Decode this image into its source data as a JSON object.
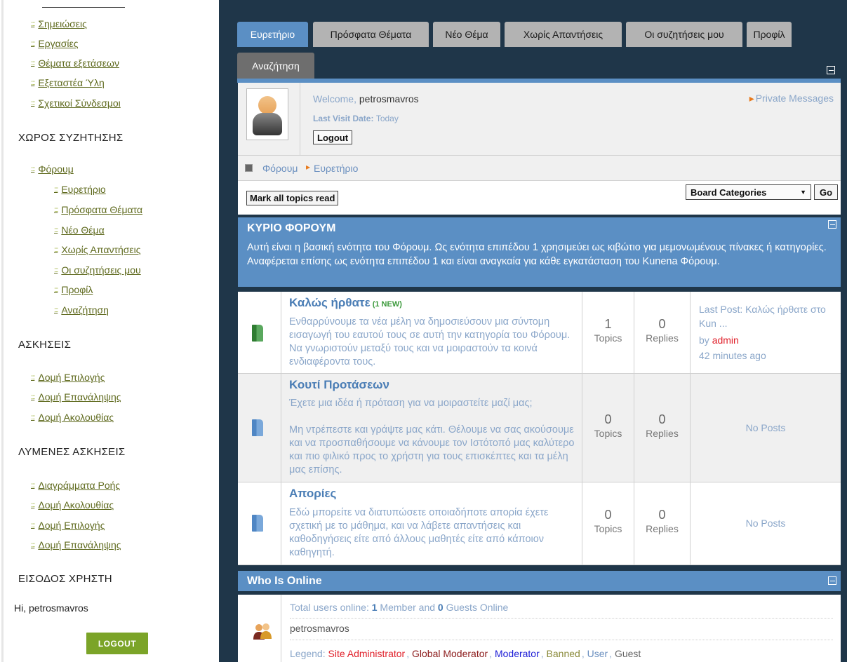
{
  "sidebar": {
    "top_links": [
      "Σημειώσεις",
      "Εργασίες",
      "Θέματα εξετάσεων",
      "Εξεταστέα Ύλη",
      "Σχετικοί Σύνδεσμοι"
    ],
    "section_forum": "ΧΩΡΟΣ ΣΥΖΗΤΗΣΗΣ",
    "forum_link": "Φόρουμ",
    "forum_sublinks": [
      "Ευρετήριο",
      "Πρόσφατα Θέματα",
      "Νέο Θέμα",
      "Χωρίς Απαντήσεις",
      "Οι συζητήσεις μου",
      "Προφίλ",
      "Αναζήτηση"
    ],
    "section_exercises": "ΑΣΚΗΣΕΙΣ",
    "exercise_links": [
      "Δομή Επιλογής",
      "Δομή Επανάληψης",
      "Δομή Ακολουθίας"
    ],
    "section_solved": "ΛΥΜΕΝΕΣ ΑΣΚΗΣΕΙΣ",
    "solved_links": [
      "Διαγράμματα Ροής",
      "Δομή Ακολουθίας",
      "Δομή Επιλογής",
      "Δομή Επανάληψης"
    ],
    "section_login": "ΕΙΣΟΔΟΣ ΧΡΗΣΤΗ",
    "greeting": "Hi, petrosmavros",
    "logout_label": "LOGOUT"
  },
  "tabs": [
    "Ευρετήριο",
    "Πρόσφατα Θέματα",
    "Νέο Θέμα",
    "Χωρίς Απαντήσεις",
    "Οι συζητήσεις μου",
    "Προφίλ",
    "Αναζήτηση"
  ],
  "userbox": {
    "welcome_prefix": "Welcome, ",
    "username": "petrosmavros",
    "last_visit_label": "Last Visit Date: ",
    "last_visit_value": "Today",
    "logout_label": "Logout",
    "private_messages": "Private Messages"
  },
  "breadcrumb": [
    "Φόρουμ",
    "Ευρετήριο"
  ],
  "toolbar": {
    "mark_read_label": "Mark all topics read",
    "board_select_value": "Board Categories",
    "go_label": "Go"
  },
  "category": {
    "title": "ΚΥΡΙΟ ΦΟΡΟΥΜ",
    "description": "Αυτή είναι η βασική ενότητα του Φόρουμ. Ως ενότητα επιπέδου 1 χρησιμεύει ως κιβώτιο για μεμονωμένους πίνακες ή κατηγορίες. Αναφέρεται επίσης ως ενότητα επιπέδου 1 και είναι αναγκαία για κάθε εγκατάσταση του Κunena Φόρουμ."
  },
  "forums": [
    {
      "title": "Καλώς ήρθατε",
      "new_badge": "(1 NEW)",
      "description": "Ενθαρρύνουμε τα νέα μέλη να δημοσιεύσουν μια σύντομη εισαγωγή του εαυτού τους σε αυτή την κατηγορία του Φόρουμ. Να γνωριστούν μεταξύ τους και να μοιραστούν τα κοινά ενδιαφέροντα τους.",
      "topics": "1",
      "topics_label": "Topics",
      "replies": "0",
      "replies_label": "Replies",
      "last_post": "Last Post: Καλώς ήρθατε στο Kun ...",
      "by_label": "by ",
      "author": "admin",
      "time_ago": "42 minutes ago"
    },
    {
      "title": "Κουτί Προτάσεων",
      "description": "Έχετε μια ιδέα ή πρόταση για να μοιραστείτε μαζί μας;",
      "description_2": "Μη ντρέπεστε και γράψτε μας κάτι. Θέλουμε να σας ακούσουμε και να προσπαθήσουμε να κάνουμε τον Ιστότοπό μας καλύτερο και πιο φιλικό προς το χρήστη για τους επισκέπτες και τα μέλη μας επίσης.",
      "topics": "0",
      "topics_label": "Topics",
      "replies": "0",
      "replies_label": "Replies",
      "no_posts": "No Posts"
    },
    {
      "title": "Απορίες",
      "description": "Εδώ μπορείτε να διατυπώσετε οποιαδήποτε απορία έχετε σχετική με το μάθημα, και να λάβετε απαντήσεις και καθοδηγήσεις είτε από άλλους μαθητές είτε από κάποιον καθηγητή.",
      "topics": "0",
      "topics_label": "Topics",
      "replies": "0",
      "replies_label": "Replies",
      "no_posts": "No Posts"
    }
  ],
  "online": {
    "title": "Who Is Online",
    "total_prefix": "Total users online: ",
    "members_count": "1",
    "members_mid": " Member and ",
    "guests_count": "0",
    "guests_suffix": " Guests Online",
    "user": "petrosmavros",
    "legend_label": "Legend: ",
    "legend": [
      {
        "label": "Site Administrator",
        "color": "#e0202a"
      },
      {
        "label": "Global Moderator",
        "color": "#8b1a1a"
      },
      {
        "label": "Moderator",
        "color": "#1d1dd6"
      },
      {
        "label": "Banned",
        "color": "#8a8a3a"
      },
      {
        "label": "User",
        "color": "#6a8fbf"
      },
      {
        "label": "Guest",
        "color": "#666666"
      }
    ]
  }
}
